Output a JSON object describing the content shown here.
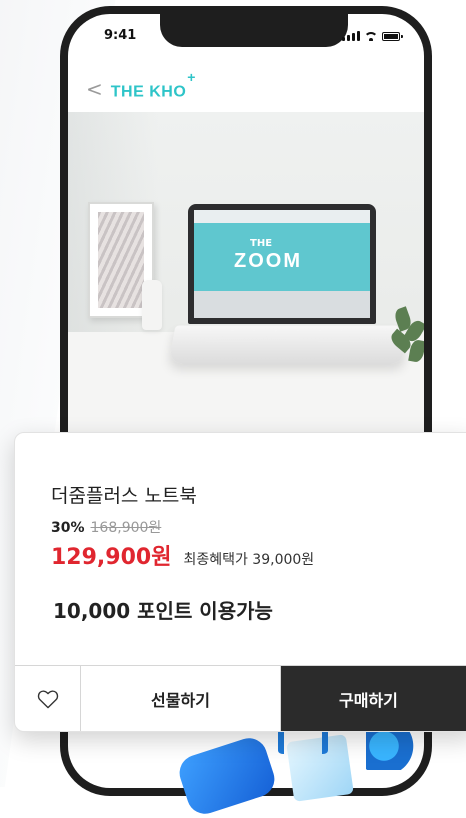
{
  "status_bar": {
    "time": "9:41"
  },
  "app_bar": {
    "back_label": "<",
    "brand": "THE KHO",
    "brand_sup": "+"
  },
  "photo_screen": {
    "line1": "THE",
    "line2": "ZOOM"
  },
  "product": {
    "name": "더줌플러스 노트북",
    "discount_percent": "30%",
    "original_price": "168,900원",
    "sale_price": "129,900원",
    "best_benefit": "최종혜택가 39,000원",
    "points_notice": "10,000 포인트 이용가능"
  },
  "actions": {
    "wishlist_icon": "heart-outline",
    "gift_label": "선물하기",
    "buy_label": "구매하기"
  },
  "colors": {
    "price_red": "#e0262f",
    "buy_button": "#2b2b2b",
    "brand_teal": "#2ec4c8"
  }
}
